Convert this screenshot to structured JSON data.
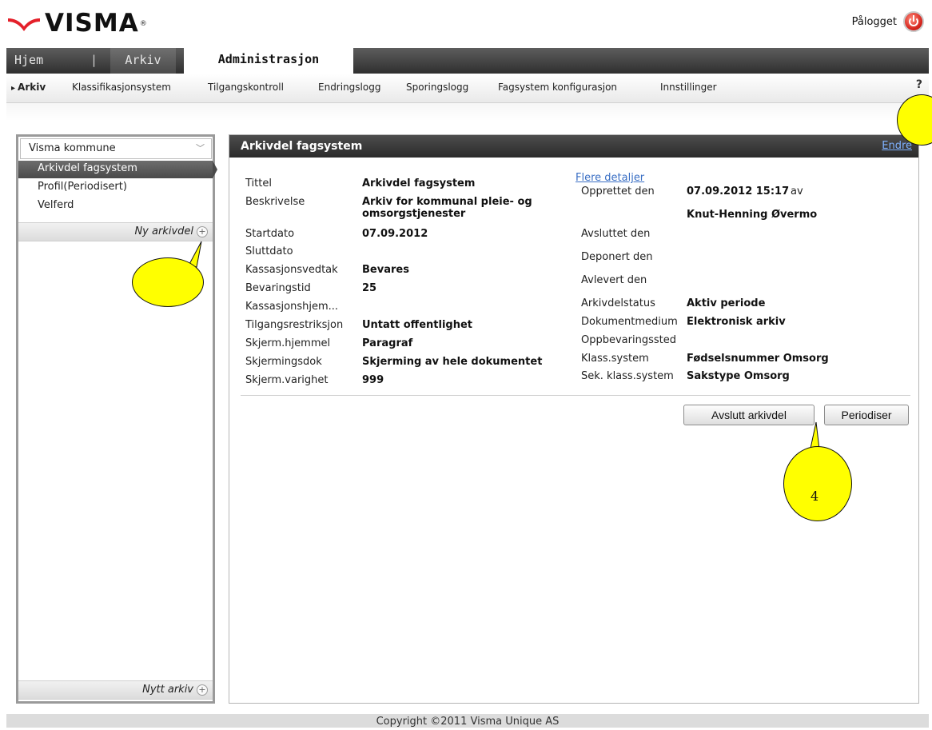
{
  "brand": {
    "name": "VISMA",
    "reg_mark": "®"
  },
  "header": {
    "login_label": "Pålogget",
    "logout_icon": "power-icon"
  },
  "tabs": [
    {
      "label": "Hjem"
    },
    {
      "label": "|"
    },
    {
      "label": "Arkiv"
    },
    {
      "label": "Administrasjon",
      "active": true
    }
  ],
  "subnav": {
    "items": [
      {
        "label": "Arkiv",
        "active": true
      },
      {
        "label": "Klassifikasjonsystem"
      },
      {
        "label": "Tilgangskontroll"
      },
      {
        "label": "Endringslogg"
      },
      {
        "label": "Sporingslogg"
      },
      {
        "label": "Fagsystem konfigurasjon"
      },
      {
        "label": "Innstillinger"
      }
    ],
    "help": "?"
  },
  "sidebar": {
    "select_value": "Visma kommune",
    "items": [
      {
        "label": "Arkivdel fagsystem",
        "active": true
      },
      {
        "label": "Profil(Periodisert)"
      },
      {
        "label": "Velferd"
      }
    ],
    "new_archive_part": "Ny arkivdel",
    "new_archive": "Nytt arkiv"
  },
  "main": {
    "title": "Arkivdel fagsystem",
    "edit_link": "Endre",
    "more_details": "Flere detaljer",
    "left_fields": [
      {
        "label": "Tittel",
        "value": "Arkivdel fagsystem"
      },
      {
        "label": "Beskrivelse",
        "value": "Arkiv for kommunal pleie- og",
        "value2": "omsorgstjenester"
      },
      {
        "label": "Startdato",
        "value": "07.09.2012"
      },
      {
        "label": "Sluttdato",
        "value": ""
      },
      {
        "label": "Kassasjonsvedtak",
        "value": "Bevares"
      },
      {
        "label": "Bevaringstid",
        "value": "25"
      },
      {
        "label": "Kassasjonshjem...",
        "value": ""
      },
      {
        "label": "Tilgangsrestriksjon",
        "value": "Untatt offentlighet"
      },
      {
        "label": "Skjerm.hjemmel",
        "value": "Paragraf"
      },
      {
        "label": "Skjermingsdok",
        "value": "Skjerming av hele dokumentet"
      },
      {
        "label": "Skjerm.varighet",
        "value": "999"
      }
    ],
    "right_fields": [
      {
        "label": "Opprettet den",
        "value": "07.09.2012 15:17",
        "suffix": "av",
        "value2": "Knut-Henning Øvermo"
      },
      {
        "label": "Avsluttet den",
        "value": ""
      },
      {
        "label": "Deponert den",
        "value": ""
      },
      {
        "label": "Avlevert den",
        "value": ""
      },
      {
        "label": "Arkivdelstatus",
        "value": "Aktiv periode"
      },
      {
        "label": "Dokumentmedium",
        "value": "Elektronisk arkiv"
      },
      {
        "label": "Oppbevaringssted",
        "value": ""
      },
      {
        "label": "Klass.system",
        "value": "Fødselsnummer Omsorg"
      },
      {
        "label": "Sek. klass.system",
        "value": "Sakstype Omsorg"
      }
    ],
    "buttons": {
      "close": "Avslutt arkivdel",
      "periodize": "Periodiser"
    }
  },
  "callouts": {
    "number": "4",
    "color": "#ffff00"
  },
  "footer": {
    "copyright": "Copyright ©2011 Visma Unique AS"
  },
  "colors": {
    "brand_red": "#e4202a",
    "tab_dark": "#2f2f2f",
    "link": "#3a6fc4"
  }
}
